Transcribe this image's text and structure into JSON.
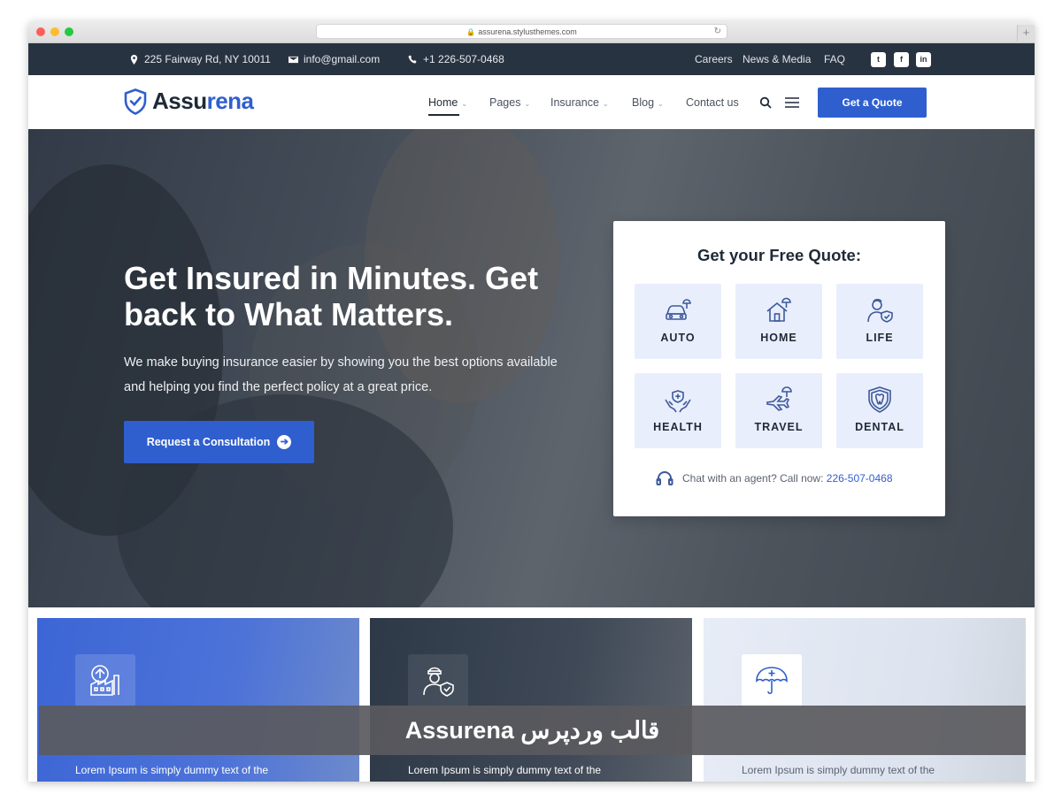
{
  "browser": {
    "url": "assurena.stylusthemes.com",
    "lock_icon": "lock-icon",
    "reload_icon": "reload-icon",
    "new_tab_glyph": "+"
  },
  "topbar": {
    "address": "225 Fairway Rd, NY 10011",
    "email": "info@gmail.com",
    "phone": "+1 226-507-0468",
    "links": [
      "Careers",
      "News & Media",
      "FAQ"
    ],
    "social": [
      "twitter-icon",
      "facebook-icon",
      "linkedin-icon"
    ],
    "social_glyphs": [
      "t",
      "f",
      "in"
    ]
  },
  "nav": {
    "logo_prefix": "Assu",
    "logo_suffix": "rena",
    "items": [
      {
        "label": "Home",
        "has_dropdown": true,
        "active": true
      },
      {
        "label": "Pages",
        "has_dropdown": true
      },
      {
        "label": "Insurance",
        "has_dropdown": true
      },
      {
        "label": "Blog",
        "has_dropdown": true
      },
      {
        "label": "Contact us",
        "has_dropdown": false
      }
    ],
    "chevron": "⌄",
    "cta": "Get a Quote"
  },
  "hero": {
    "title": "Get Insured in Minutes. Get back to What Matters.",
    "subtitle": "We make buying insurance easier by showing you the best options available and helping you find the perfect policy at a great price.",
    "button": "Request a Consultation",
    "button_arrow": "➔"
  },
  "quote_card": {
    "title": "Get your Free Quote:",
    "tiles": [
      {
        "label": "AUTO",
        "icon": "car-icon"
      },
      {
        "label": "HOME",
        "icon": "house-icon"
      },
      {
        "label": "LIFE",
        "icon": "person-shield-icon"
      },
      {
        "label": "HEALTH",
        "icon": "hands-heart-icon"
      },
      {
        "label": "TRAVEL",
        "icon": "airplane-icon"
      },
      {
        "label": "DENTAL",
        "icon": "tooth-shield-icon"
      }
    ],
    "chat_text": "Chat with an agent? Call now: ",
    "chat_phone": "226-507-0468"
  },
  "features": [
    {
      "text": "Lorem Ipsum is simply dummy text of the",
      "icon": "factory-icon"
    },
    {
      "text": "Lorem Ipsum is simply dummy text of the",
      "icon": "agent-shield-icon"
    },
    {
      "text": "Lorem Ipsum is simply dummy text of the",
      "icon": "umbrella-icon"
    }
  ],
  "banner": "قالب وردپرس Assurena",
  "colors": {
    "primary": "#2f5fce",
    "dark": "#283341",
    "tile_bg": "#e9eefc"
  }
}
